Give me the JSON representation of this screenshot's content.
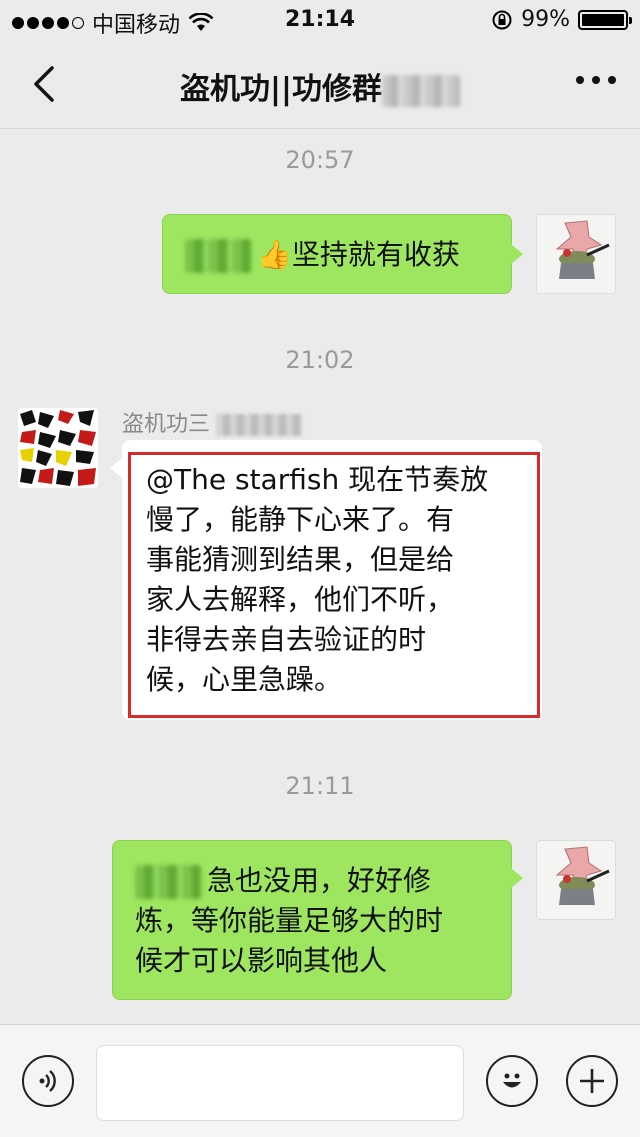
{
  "status_bar": {
    "carrier": "中国移动",
    "time": "21:14",
    "battery": "99%",
    "battery_level": 0.99
  },
  "nav": {
    "title": "盗机功||功修群"
  },
  "messages": [
    {
      "timestamp": "20:57",
      "side": "right",
      "text": "👍坚持就有收获"
    },
    {
      "timestamp": "21:02",
      "side": "left",
      "sender": "盗机功三",
      "lines": [
        "@The starfish 现在节奏放",
        "慢了，能静下心来了。有",
        "事能猜测到结果，但是给",
        "家人去解释，他们不听，",
        "非得去亲自去验证的时",
        "候，心里急躁。"
      ]
    },
    {
      "timestamp": "21:11",
      "side": "right",
      "lines": [
        "急也没用，好好修",
        "炼，等你能量足够大的时",
        "候才可以影响其他人"
      ]
    }
  ],
  "input": {
    "value": ""
  },
  "colors": {
    "bubble_green": "#9ee65f",
    "background": "#ebebeb",
    "highlight_red": "#d72b2b"
  }
}
